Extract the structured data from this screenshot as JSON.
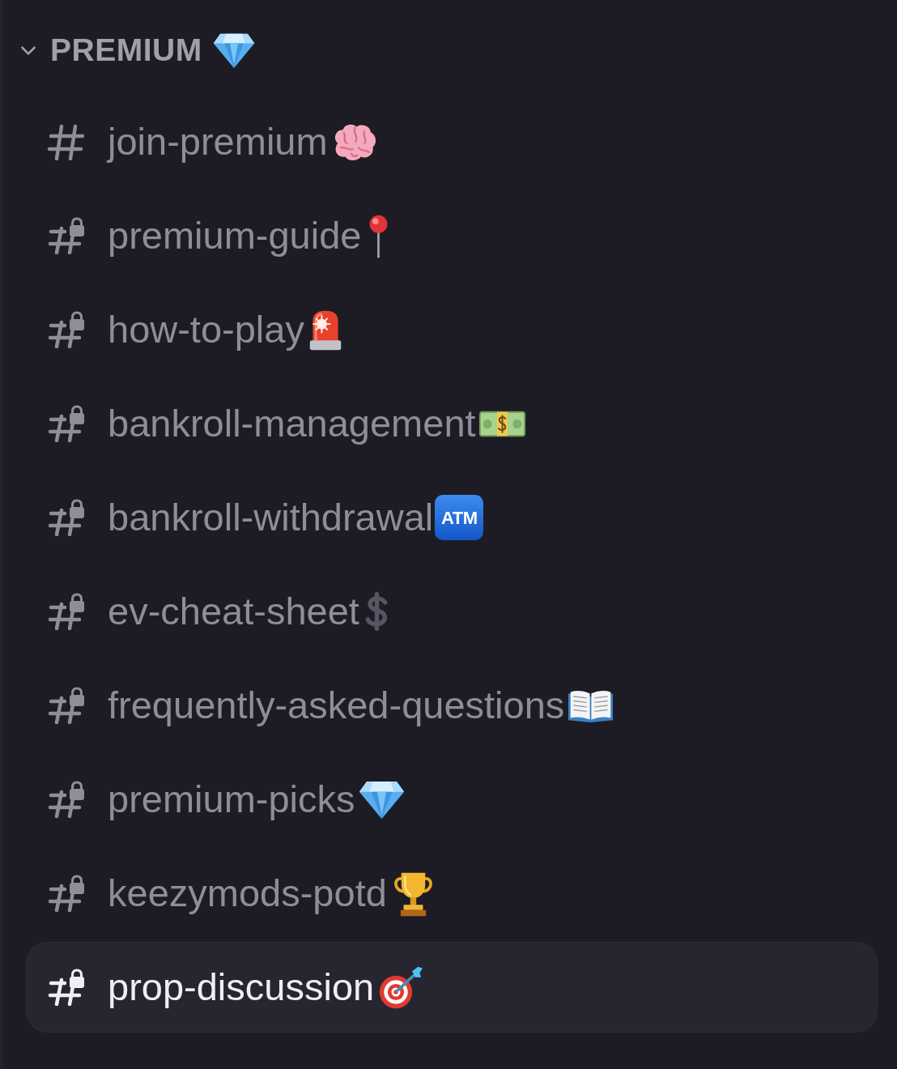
{
  "category": {
    "name": "PREMIUM",
    "expanded": true
  },
  "channels": [
    {
      "name": "join-premium",
      "locked": false,
      "selected": false
    },
    {
      "name": "premium-guide",
      "locked": true,
      "selected": false
    },
    {
      "name": "how-to-play",
      "locked": true,
      "selected": false
    },
    {
      "name": "bankroll-management",
      "locked": true,
      "selected": false
    },
    {
      "name": "bankroll-withdrawal",
      "locked": true,
      "selected": false,
      "emoji_label": "ATM"
    },
    {
      "name": "ev-cheat-sheet",
      "locked": true,
      "selected": false
    },
    {
      "name": "frequently-asked-questions",
      "locked": true,
      "selected": false
    },
    {
      "name": "premium-picks",
      "locked": true,
      "selected": false
    },
    {
      "name": "keezymods-potd",
      "locked": true,
      "selected": false
    },
    {
      "name": "prop-discussion",
      "locked": true,
      "selected": true
    }
  ]
}
